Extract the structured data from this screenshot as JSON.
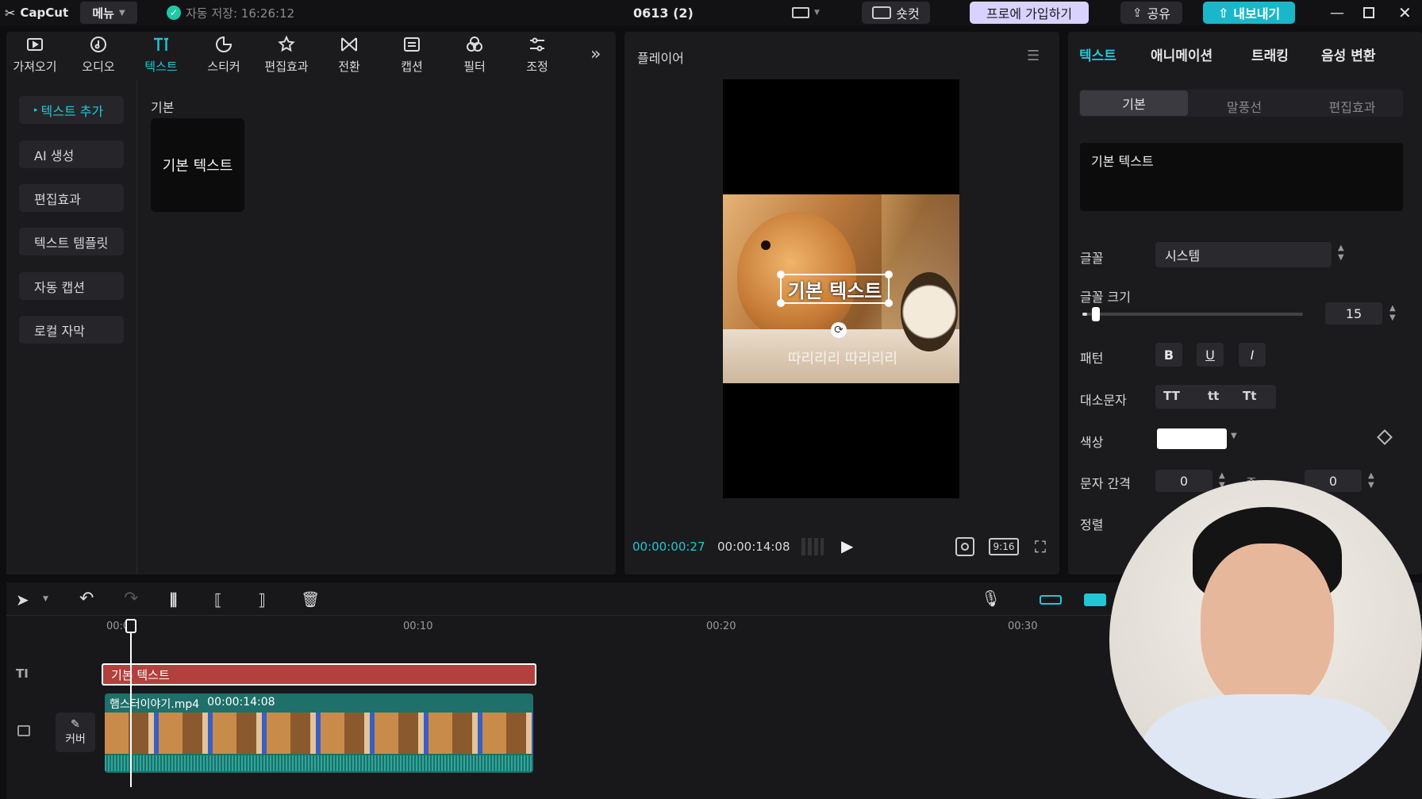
{
  "topbar": {
    "logo": "CapCut",
    "menu": "메뉴",
    "autosave": "자동 저장: 16:26:12",
    "project_title": "0613 (2)",
    "shortcut": "숏컷",
    "pro": "프로에 가입하기",
    "share": "공유",
    "export": "내보내기"
  },
  "toolbar": {
    "items": [
      {
        "label": "가져오기",
        "icon": "import-icon"
      },
      {
        "label": "오디오",
        "icon": "audio-icon"
      },
      {
        "label": "텍스트",
        "icon": "text-icon"
      },
      {
        "label": "스티커",
        "icon": "sticker-icon"
      },
      {
        "label": "편집효과",
        "icon": "effects-icon"
      },
      {
        "label": "전환",
        "icon": "transition-icon"
      },
      {
        "label": "캡션",
        "icon": "caption-icon"
      },
      {
        "label": "필터",
        "icon": "filter-icon"
      },
      {
        "label": "조정",
        "icon": "adjust-icon"
      }
    ],
    "more": "»"
  },
  "sidebar": {
    "items": [
      "텍스트 추가",
      "AI 생성",
      "편집효과",
      "텍스트 템플릿",
      "자동 캡션",
      "로컬 자막"
    ]
  },
  "library": {
    "section": "기본",
    "card_label": "기본 텍스트"
  },
  "player": {
    "title": "플레이어",
    "overlay_text": "기본 텍스트",
    "subtitle_text": "따리리리 따리리리",
    "time_current": "00:00:00:27",
    "time_total": "00:00:14:08",
    "ratio": "9:16"
  },
  "inspector": {
    "tabs": [
      "텍스트",
      "애니메이션",
      "트래킹",
      "음성 변환"
    ],
    "subtabs": [
      "기본",
      "말풍선",
      "편집효과"
    ],
    "text_value": "기본 텍스트",
    "font_label": "글꼴",
    "font_value": "시스템",
    "size_label": "글꼴 크기",
    "size_value": "15",
    "size_fraction": 0.02,
    "pattern_label": "패턴",
    "pattern_buttons": [
      "B",
      "U",
      "I"
    ],
    "case_label": "대소문자",
    "case_buttons": [
      "TT",
      "tt",
      "Tt"
    ],
    "color_label": "색상",
    "color_value": "#ffffff",
    "spacing_label": "문자 간격",
    "spacing_value": "0",
    "line_label": "줄...",
    "line_value": "0",
    "align_label": "정렬"
  },
  "timeline": {
    "ticks": [
      "00:00",
      "00:10",
      "00:20",
      "00:30"
    ],
    "text_clip": "기본 텍스트",
    "video_clip_name": "햄스터이야기.mp4",
    "video_clip_duration": "00:00:14:08",
    "cover_label": "커버"
  },
  "colors": {
    "accent": "#1fc8d4",
    "text_clip": "#b2403c",
    "video_clip": "#1f6f6a",
    "pro_button": "#d9d2ff",
    "export_button": "#19b7c9"
  }
}
